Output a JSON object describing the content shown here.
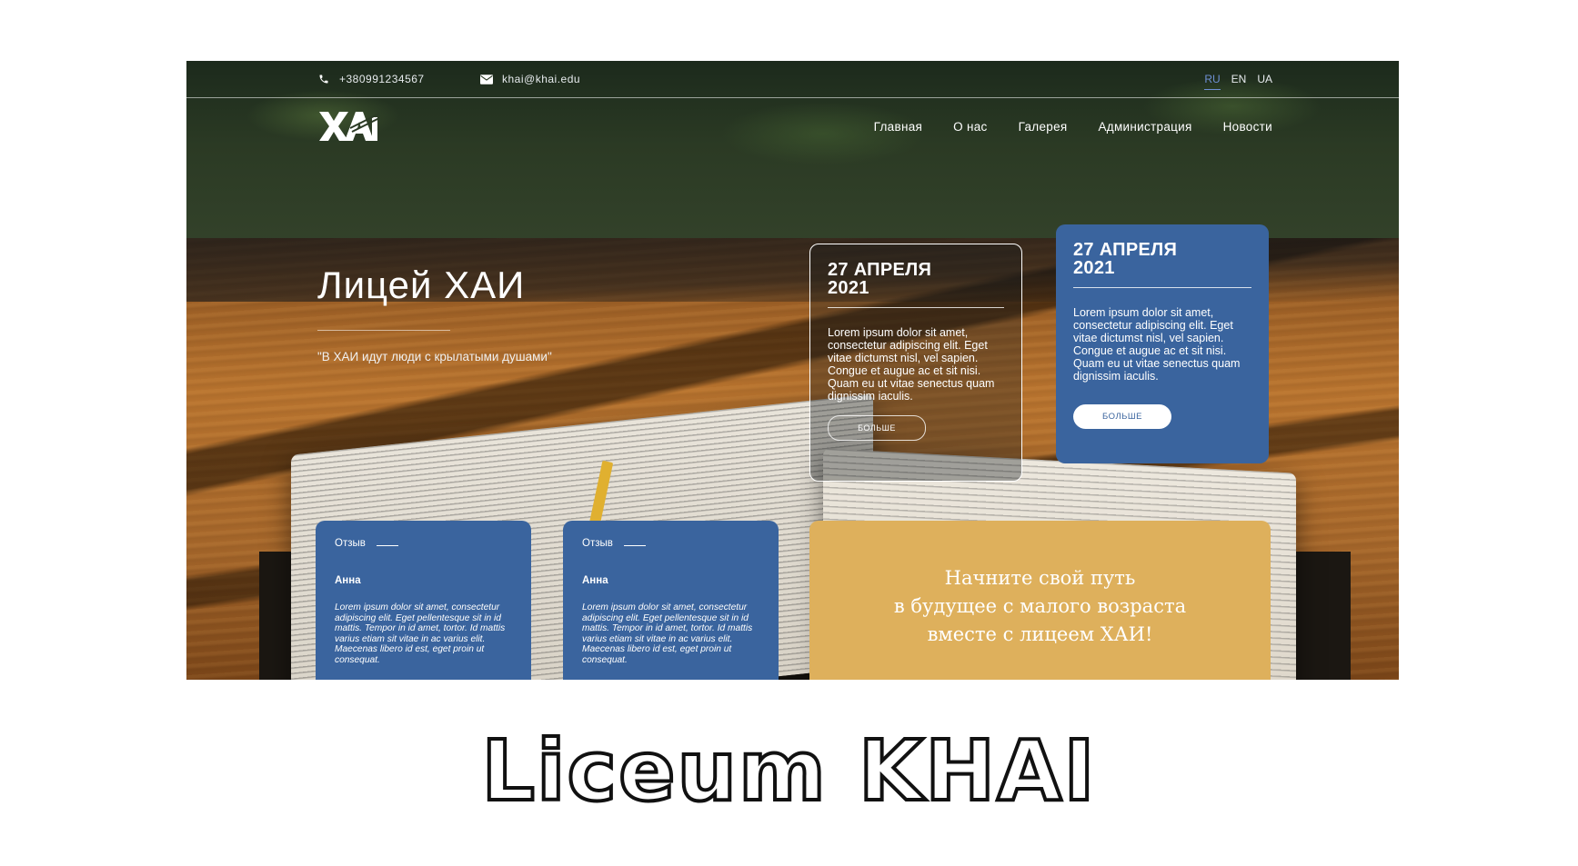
{
  "topbar": {
    "phone": "+380991234567",
    "email": "khai@khai.edu",
    "languages": [
      "RU",
      "EN",
      "UA"
    ],
    "active_language": "RU"
  },
  "nav": {
    "items": [
      "Главная",
      "О нас",
      "Галерея",
      "Администрация",
      "Новости"
    ]
  },
  "logo": {
    "text": "ХАІ"
  },
  "hero": {
    "title": "Лицей ХАИ",
    "quote": "\"В ХАИ идут люди с крылатыми душами\""
  },
  "events": [
    {
      "date": "27 АПРЕЛЯ 2021",
      "text": "Lorem ipsum dolor sit amet, consectetur adipiscing elit. Eget vitae dictumst nisl, vel sapien. Congue et augue ac et sit nisi. Quam eu ut vitae senectus quam dignissim iaculis.",
      "button": "БОЛЬШЕ"
    },
    {
      "date": "27 АПРЕЛЯ 2021",
      "text": "Lorem ipsum dolor sit amet, consectetur adipiscing elit. Eget vitae dictumst nisl, vel sapien. Congue et augue ac et sit nisi. Quam eu ut vitae senectus quam dignissim iaculis.",
      "button": "БОЛЬШЕ"
    }
  ],
  "reviews": [
    {
      "label": "Отзыв",
      "name": "Анна",
      "text": "Lorem ipsum dolor sit amet, consectetur adipiscing elit. Eget pellentesque sit in id mattis. Tempor in id amet, tortor. Id mattis varius etiam sit vitae in ac varius elit. Maecenas libero id est, eget proin ut consequat."
    },
    {
      "label": "Отзыв",
      "name": "Анна",
      "text": "Lorem ipsum dolor sit amet, consectetur adipiscing elit. Eget pellentesque sit in id mattis. Tempor in id amet, tortor. Id mattis varius etiam sit vitae in ac varius elit. Maecenas libero id est, eget proin ut consequat."
    }
  ],
  "promo": {
    "lines": [
      "Начните свой путь",
      "в будущее с малого возраста",
      "вместе с лицеем ХАИ!"
    ]
  },
  "caption": "Liceum KHAI",
  "colors": {
    "accent_blue": "#3a649e",
    "promo_gold": "#deb05c",
    "active_lang": "#6f90d4"
  },
  "icons": {
    "phone": "phone-icon",
    "email": "envelope-icon"
  }
}
